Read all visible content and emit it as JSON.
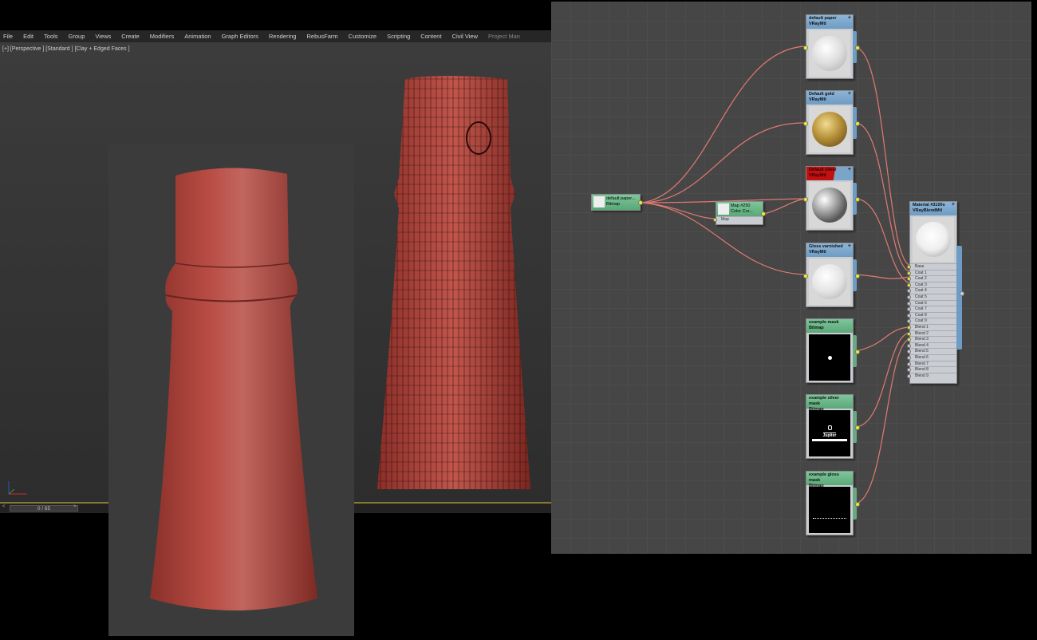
{
  "menu": [
    "File",
    "Edit",
    "Tools",
    "Group",
    "Views",
    "Create",
    "Modifiers",
    "Animation",
    "Graph Editors",
    "Rendering",
    "RebusFarm",
    "Customize",
    "Scripting",
    "Content",
    "Civil View",
    "Project Man"
  ],
  "viewport_label": "[+] [Perspective ] [Standard ] [Clay + Edged Faces ]",
  "timeline": {
    "frame": "0 / 65",
    "prev": "<",
    "next": ">"
  },
  "nodes": {
    "paper": {
      "title": "default paper",
      "type": "VRayMtl"
    },
    "gold": {
      "title": "Default gold",
      "type": "VRayMtl"
    },
    "silver": {
      "title": "Default silver",
      "type": "VRayMtl"
    },
    "gloss": {
      "title": "Gloss varnished",
      "type": "VRayMtl"
    },
    "bitmap": {
      "title": "default paper...",
      "type": "Bitmap"
    },
    "colorcorrect": {
      "title": "Map #250",
      "type": "Color Cor...",
      "slot": "Map"
    },
    "mask1": {
      "title": "example mask",
      "type": "Bitmap"
    },
    "mask2": {
      "title": "example silver mask",
      "type": "Bitmap",
      "thumb_text": "Jupiter"
    },
    "mask3": {
      "title": "example gloss mask",
      "type": "Bitmap"
    },
    "blend": {
      "title": "Material #3100s",
      "type": "VRayBlendMtl",
      "slots": [
        "Base",
        "Coat 1",
        "Coat 2",
        "Coat 3",
        "Coat 4",
        "Coat 5",
        "Coat 6",
        "Coat 7",
        "Coat 8",
        "Coat 9",
        "Blend 1",
        "Blend 2",
        "Blend 3",
        "Blend 4",
        "Blend 5",
        "Blend 6",
        "Blend 7",
        "Blend 8",
        "Blend 9"
      ],
      "connected": [
        0,
        1,
        2,
        3,
        10,
        11,
        12
      ]
    }
  },
  "colors": {
    "clay": "#b04a42",
    "wire": "#e07a72",
    "port": "#e8f020"
  }
}
